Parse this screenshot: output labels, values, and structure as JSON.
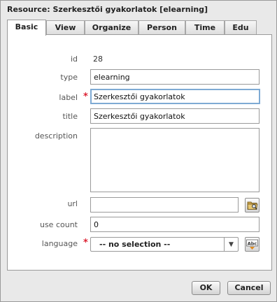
{
  "dialog": {
    "title": "Resource: Szerkesztői gyakorlatok [elearning]"
  },
  "tabs": [
    {
      "label": "Basic",
      "active": true
    },
    {
      "label": "View"
    },
    {
      "label": "Organize"
    },
    {
      "label": "Person"
    },
    {
      "label": "Time"
    },
    {
      "label": "Edu"
    }
  ],
  "form": {
    "id_label": "id",
    "id_value": "28",
    "type_label": "type",
    "type_value": "elearning",
    "label_label": "label",
    "label_value": "Szerkesztői gyakorlatok",
    "title_label": "title",
    "title_value": "Szerkesztői gyakorlatok",
    "description_label": "description",
    "description_value": "",
    "url_label": "url",
    "url_value": "",
    "use_count_label": "use count",
    "use_count_value": "0",
    "language_label": "language",
    "language_value": "-- no selection --",
    "required_mark": "*"
  },
  "icons": {
    "browse": "folder-browse-icon",
    "dropdown": "chevron-down-icon",
    "spellcheck": "abc-spellcheck-icon",
    "spellcheck_text": "Abc"
  },
  "buttons": {
    "ok": "OK",
    "cancel": "Cancel"
  },
  "colors": {
    "required": "#dd2233",
    "focus_border": "#7eaad4"
  }
}
